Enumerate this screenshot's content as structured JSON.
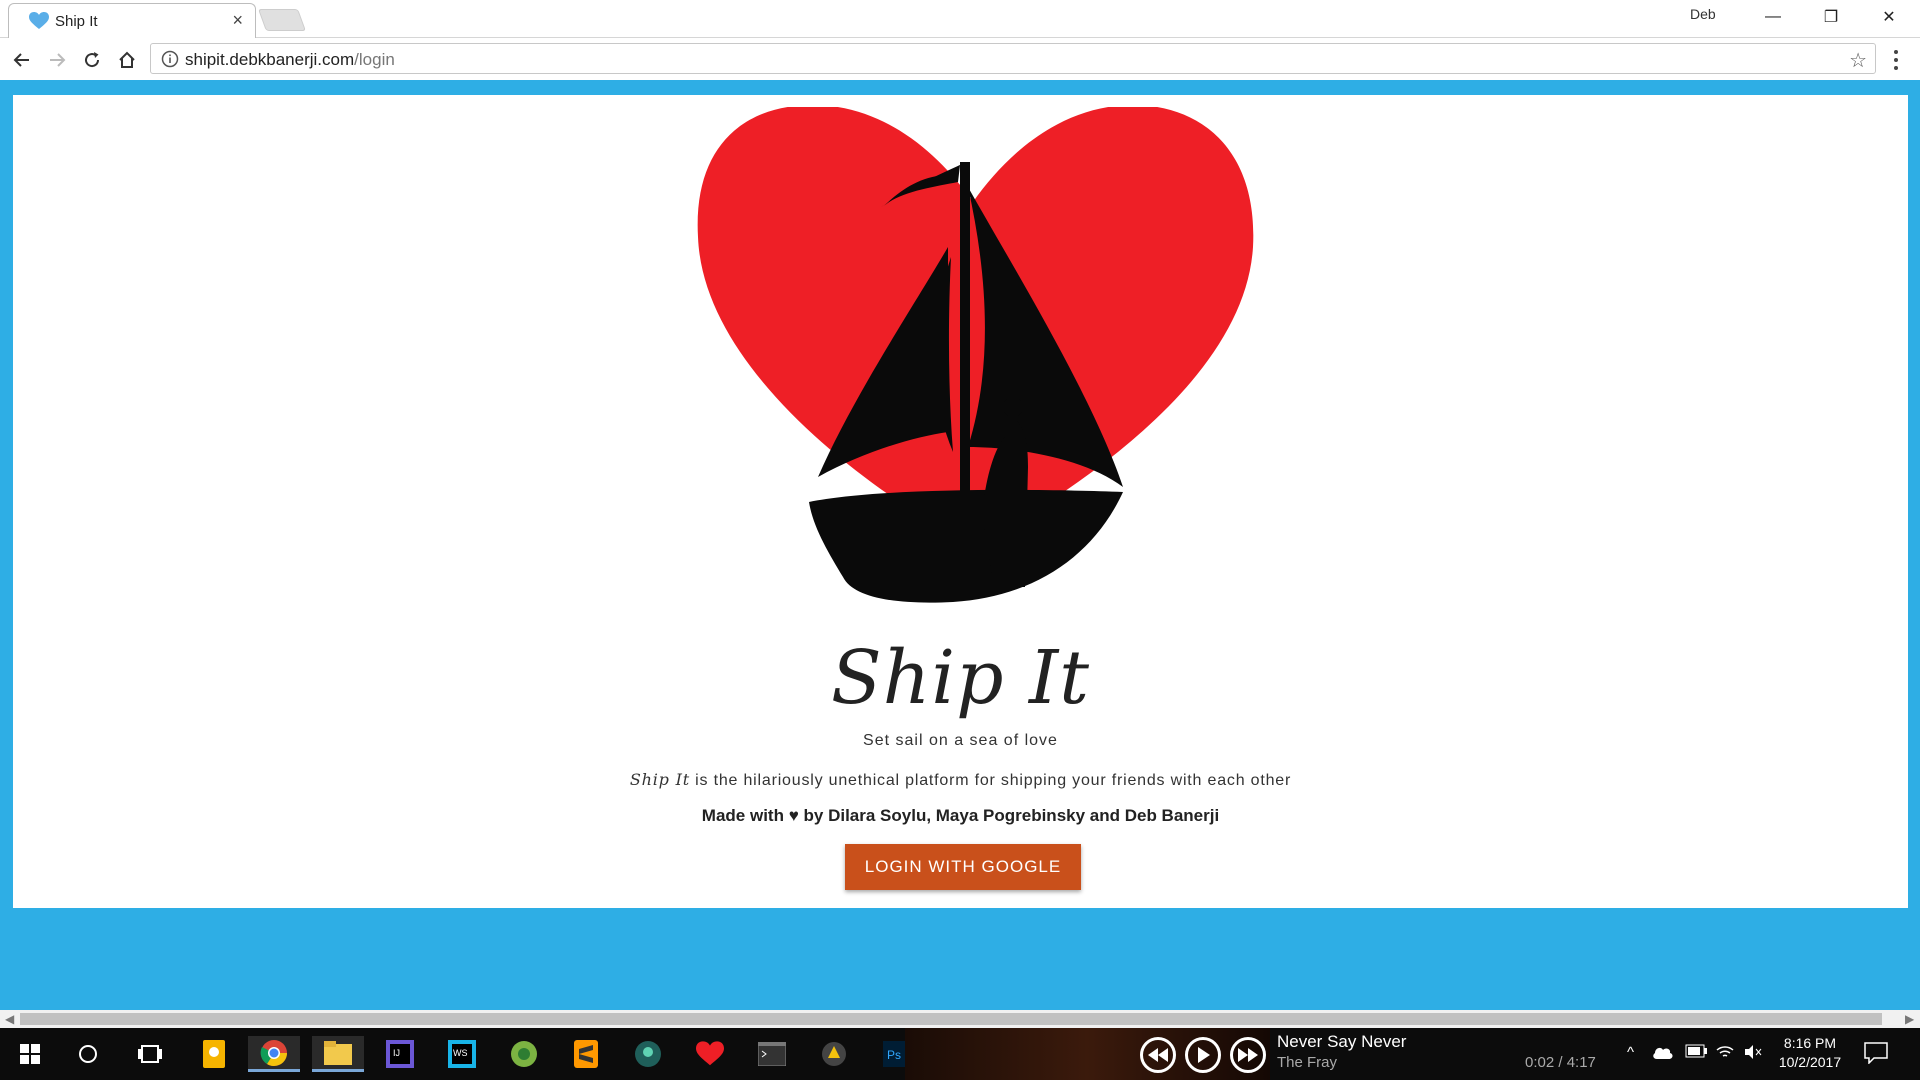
{
  "browser": {
    "tab_title": "Ship It",
    "tab_close": "×",
    "user": "Deb",
    "window_controls": {
      "minimize": "—",
      "restore": "❐",
      "close": "✕"
    },
    "url_host": "shipit.debkbanerji.com",
    "url_path": "/login",
    "icons": [
      "back-icon",
      "forward-icon",
      "reload-icon",
      "home-icon",
      "info-icon",
      "star-icon",
      "menu-icon"
    ]
  },
  "page": {
    "title": "Ship It",
    "tagline": "Set sail on a sea of love",
    "description_em": "Ship It",
    "description_rest": " is the hilariously unethical platform for shipping your friends with each other",
    "credits": "Made with ♥ by Dilara Soylu, Maya Pogrebinsky and Deb Banerji",
    "login_button": "LOGIN WITH GOOGLE",
    "colors": {
      "background": "#2eaee5",
      "heart": "#ee1f26",
      "button": "#c9501b"
    }
  },
  "taskbar": {
    "apps": [
      "windows-start",
      "search",
      "task-view",
      "keep",
      "chrome",
      "file-explorer",
      "intellij",
      "webstorm",
      "android-studio",
      "sublime-text",
      "gitkraken",
      "heart-app",
      "terminal",
      "unity",
      "photoshop"
    ],
    "media": {
      "song": "Never Say Never",
      "artist": "The Fray",
      "progress": "0:02 / 4:17"
    },
    "tray_chevron": "^",
    "clock_time": "8:16 PM",
    "clock_date": "10/2/2017"
  }
}
